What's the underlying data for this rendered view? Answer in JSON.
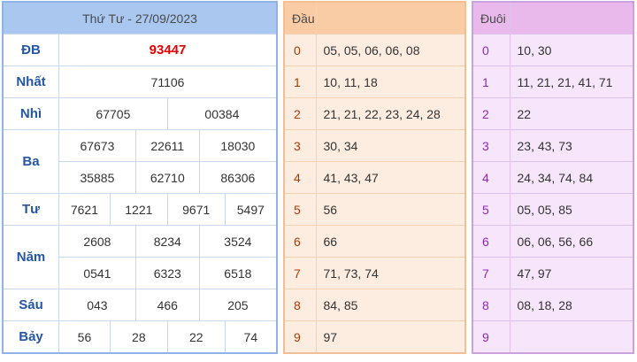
{
  "results": {
    "title": "Thứ Tư - 27/09/2023",
    "rows": [
      {
        "label": "ĐB",
        "values": [
          "93447"
        ]
      },
      {
        "label": "Nhất",
        "values": [
          "71106"
        ]
      },
      {
        "label": "Nhì",
        "values": [
          "67705",
          "00384"
        ]
      },
      {
        "label": "Ba",
        "values": [
          "67673",
          "22611",
          "18030",
          "35885",
          "62710",
          "86306"
        ]
      },
      {
        "label": "Tư",
        "values": [
          "7621",
          "1221",
          "9671",
          "5497"
        ]
      },
      {
        "label": "Năm",
        "values": [
          "2608",
          "8234",
          "3524",
          "0541",
          "6323",
          "6518"
        ]
      },
      {
        "label": "Sáu",
        "values": [
          "043",
          "466",
          "205"
        ]
      },
      {
        "label": "Bảy",
        "values": [
          "56",
          "28",
          "22",
          "74"
        ]
      }
    ]
  },
  "dau": {
    "header": "Đầu",
    "rows": [
      {
        "key": "0",
        "values": "05, 05, 06, 06, 08"
      },
      {
        "key": "1",
        "values": "10, 11, 18"
      },
      {
        "key": "2",
        "values": "21, 21, 22, 23, 24, 28"
      },
      {
        "key": "3",
        "values": "30, 34"
      },
      {
        "key": "4",
        "values": "41, 43, 47"
      },
      {
        "key": "5",
        "values": "56"
      },
      {
        "key": "6",
        "values": "66"
      },
      {
        "key": "7",
        "values": "71, 73, 74"
      },
      {
        "key": "8",
        "values": "84, 85"
      },
      {
        "key": "9",
        "values": "97"
      }
    ]
  },
  "duoi": {
    "header": "Đuôi",
    "rows": [
      {
        "key": "0",
        "values": "10, 30"
      },
      {
        "key": "1",
        "values": "11, 21, 21, 41, 71"
      },
      {
        "key": "2",
        "values": "22"
      },
      {
        "key": "3",
        "values": "23, 43, 73"
      },
      {
        "key": "4",
        "values": "24, 34, 74, 84"
      },
      {
        "key": "5",
        "values": "05, 05, 85"
      },
      {
        "key": "6",
        "values": "06, 06, 56, 66"
      },
      {
        "key": "7",
        "values": "47, 97"
      },
      {
        "key": "8",
        "values": "08, 18, 28"
      },
      {
        "key": "9",
        "values": ""
      }
    ]
  },
  "colors": {
    "special_prize": "#e60000",
    "label_blue": "#2456a6",
    "dau_bg": "#fdece0",
    "duoi_bg": "#f7e6fb"
  }
}
